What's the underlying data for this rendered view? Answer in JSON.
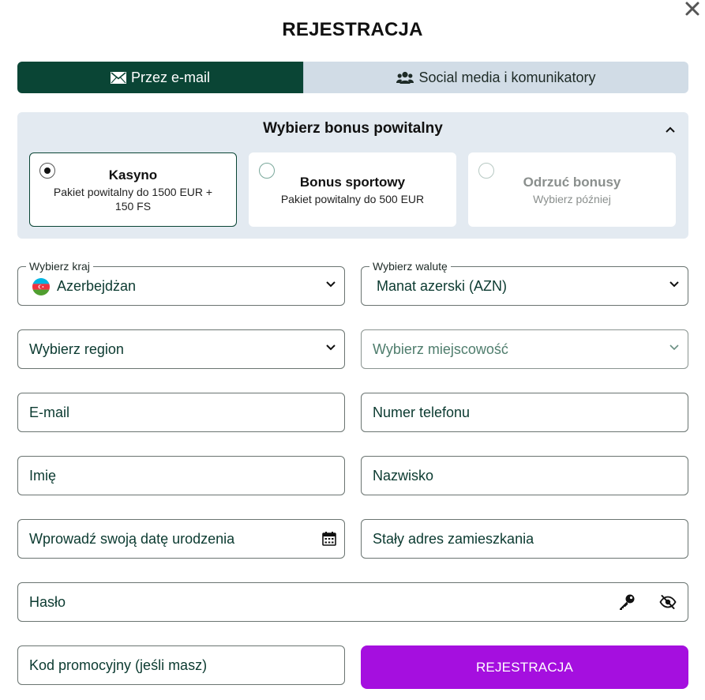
{
  "title": "REJESTRACJA",
  "tabs": [
    {
      "label": "Przez e-mail",
      "icon": "envelope-icon",
      "active": true
    },
    {
      "label": "Social media i komunikatory",
      "icon": "users-icon",
      "active": false
    }
  ],
  "bonus": {
    "heading": "Wybierz bonus powitalny",
    "options": [
      {
        "title": "Kasyno",
        "subtitle": "Pakiet powitalny do 1500 EUR + 150 FS",
        "selected": true
      },
      {
        "title": "Bonus sportowy",
        "subtitle": "Pakiet powitalny do 500 EUR",
        "selected": false
      },
      {
        "title": "Odrzuć bonusy",
        "subtitle": "Wybierz później",
        "selected": false
      }
    ]
  },
  "form": {
    "country": {
      "label": "Wybierz kraj",
      "value": "Azerbejdżan"
    },
    "currency": {
      "label": "Wybierz walutę",
      "value": "Manat azerski (AZN)"
    },
    "region": {
      "placeholder": "Wybierz region"
    },
    "city": {
      "placeholder": "Wybierz miejscowość"
    },
    "email": {
      "placeholder": "E-mail"
    },
    "phone": {
      "placeholder": "Numer telefonu"
    },
    "first_name": {
      "placeholder": "Imię"
    },
    "last_name": {
      "placeholder": "Nazwisko"
    },
    "birth_date": {
      "placeholder": "Wprowadź swoją datę urodzenia"
    },
    "address": {
      "placeholder": "Stały adres zamieszkania"
    },
    "password": {
      "placeholder": "Hasło"
    },
    "promo": {
      "placeholder": "Kod promocyjny (jeśli masz)"
    }
  },
  "submit_label": "REJESTRACJA",
  "colors": {
    "primary_dark_green": "#0a4535",
    "submit_purple": "#a50fdf",
    "panel_bg": "#e3eaf1",
    "tab_inactive_bg": "#d1dce6"
  }
}
